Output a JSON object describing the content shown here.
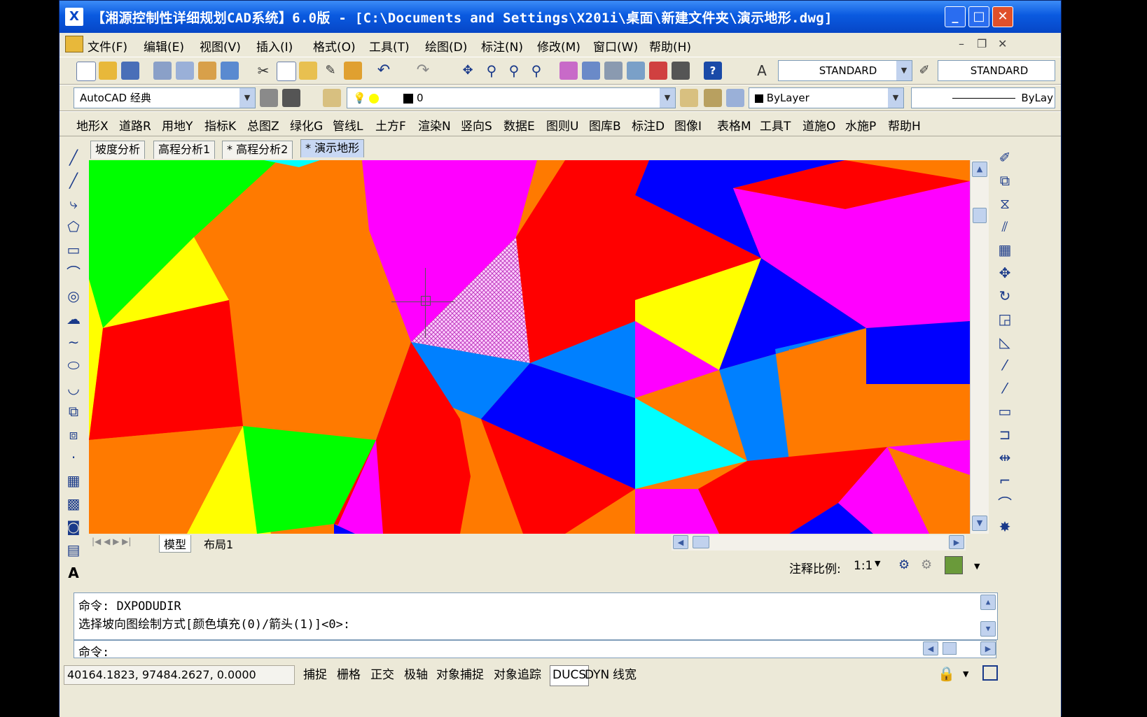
{
  "window": {
    "title": "【湘源控制性详细规划CAD系统】6.0版 - [C:\\Documents and Settings\\X201i\\桌面\\新建文件夹\\演示地形.dwg]",
    "minimize": "_",
    "maximize": "□",
    "close": "✕"
  },
  "menu": [
    "文件(F)",
    "编辑(E)",
    "视图(V)",
    "插入(I)",
    "格式(O)",
    "工具(T)",
    "绘图(D)",
    "标注(N)",
    "修改(M)",
    "窗口(W)",
    "帮助(H)"
  ],
  "toolbar1": {
    "text_style": "STANDARD",
    "dim_style": "STANDARD"
  },
  "toolbar2": {
    "workspace": "AutoCAD 经典",
    "layer": "0",
    "color": "ByLayer",
    "linetype": "ByLay"
  },
  "xiangyuan_menu": [
    "地形X",
    "道路R",
    "用地Y",
    "指标K",
    "总图Z",
    "绿化G",
    "管线L",
    "土方F",
    "渲染N",
    "竖向S",
    "数据E",
    "图则U",
    "图库B",
    "标注D",
    "图像I",
    "表格M",
    "工具T",
    "道施O",
    "水施P",
    "帮助H"
  ],
  "doc_tabs": [
    "坡度分析",
    "高程分析1",
    "* 高程分析2",
    "* 演示地形"
  ],
  "layout_tabs": [
    "模型",
    "布局1"
  ],
  "annotation_scale": {
    "label": "注释比例:",
    "value": "1:1"
  },
  "command": {
    "history": [
      "命令: DXPODUDIR",
      "选择坡向图绘制方式[颜色填充(0)/箭头(1)]<0>:"
    ],
    "prompt": "命令:"
  },
  "status": {
    "coords": "40164.1823,  97484.2627,  0.0000",
    "toggles": [
      {
        "label": "捕捉",
        "on": false
      },
      {
        "label": "栅格",
        "on": false
      },
      {
        "label": "正交",
        "on": false
      },
      {
        "label": "极轴",
        "on": false
      },
      {
        "label": "对象捕捉",
        "on": false
      },
      {
        "label": "对象追踪",
        "on": false
      },
      {
        "label": "DUCS",
        "on": true
      },
      {
        "label": "DYN",
        "on": false
      },
      {
        "label": "线宽",
        "on": false
      }
    ]
  },
  "colors": {
    "title_blue": "#0a5ae0",
    "chrome": "#ece9d8",
    "terrain": [
      "#ff7a00",
      "#ff00ff",
      "#ff0000",
      "#0000ff",
      "#ffff00",
      "#00ff00",
      "#0080ff",
      "#00ffff"
    ]
  }
}
